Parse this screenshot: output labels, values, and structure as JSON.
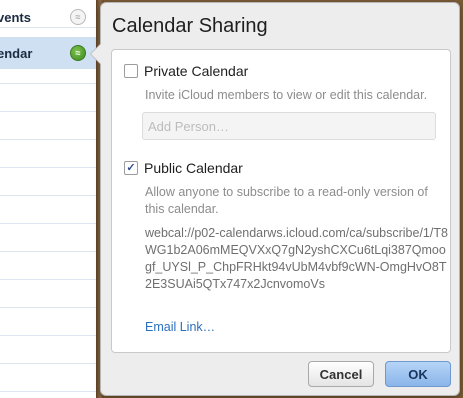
{
  "sidebar": {
    "items": [
      {
        "label": "vents",
        "icon": "share-icon"
      },
      {
        "label": "endar",
        "icon": "share-icon-active"
      }
    ]
  },
  "dialog": {
    "title": "Calendar Sharing",
    "private": {
      "label": "Private Calendar",
      "checked": false,
      "description": "Invite iCloud members to view or edit this calendar.",
      "input_placeholder": "Add Person…",
      "input_value": ""
    },
    "public": {
      "label": "Public Calendar",
      "checked": true,
      "description": "Allow anyone to subscribe to a read-only version of this calendar.",
      "url": "webcal://p02-calendarws.icloud.com/ca/subscribe/1/T8WG1b2A06mMEQVXxQ7gN2yshCXCu6tLqi387Qmoogf_UYSl_P_ChpFRHkt94vUbM4vbf9cWN-OmgHvO8T2E3SUAi5QTx747x2JcnvomoVs",
      "email_link": "Email Link…"
    },
    "buttons": {
      "cancel": "Cancel",
      "ok": "OK"
    }
  },
  "colors": {
    "accent": "#2b6fbd",
    "ok_button": "#8ab5ea",
    "active_share": "#3d8a1f"
  }
}
